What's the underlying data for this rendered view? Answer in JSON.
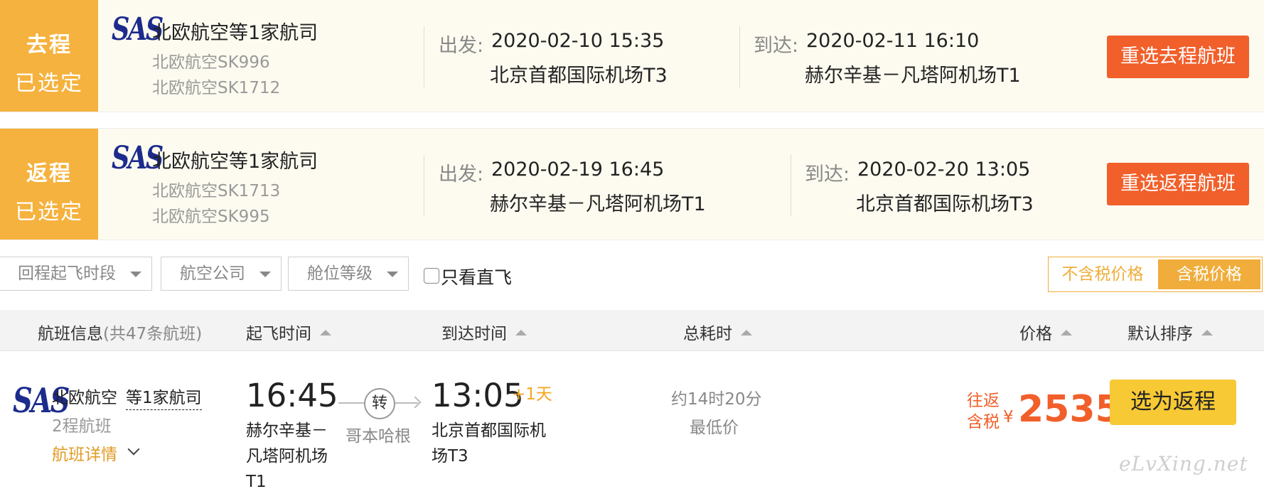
{
  "outbound": {
    "tag_line1": "去程",
    "tag_line2": "已选定",
    "logo": "SAS",
    "airline": "北欧航空等1家航司",
    "flight1": "北欧航空SK996",
    "flight2": "北欧航空SK1712",
    "dep_label": "出发:",
    "dep_datetime": "2020-02-10 15:35",
    "dep_airport": "北京首都国际机场T3",
    "arr_label": "到达:",
    "arr_datetime": "2020-02-11 16:10",
    "arr_airport": "赫尔辛基－凡塔阿机场T1",
    "reselect": "重选去程航班"
  },
  "return": {
    "tag_line1": "返程",
    "tag_line2": "已选定",
    "logo": "SAS",
    "airline": "北欧航空等1家航司",
    "flight1": "北欧航空SK1713",
    "flight2": "北欧航空SK995",
    "dep_label": "出发:",
    "dep_datetime": "2020-02-19 16:45",
    "dep_airport": "赫尔辛基－凡塔阿机场T1",
    "arr_label": "到达:",
    "arr_datetime": "2020-02-20 13:05",
    "arr_airport": "北京首都国际机场T3",
    "reselect": "重选返程航班"
  },
  "filters": {
    "time": "回程起飞时段",
    "airline": "航空公司",
    "cabin": "舱位等级",
    "direct_only": "只看直飞",
    "tax_excluded": "不含税价格",
    "tax_included": "含税价格"
  },
  "table_header": {
    "flight_info": "航班信息",
    "flight_count": "(共47条航班)",
    "dep_time": "起飞时间",
    "arr_time": "到达时间",
    "duration": "总耗时",
    "price": "价格",
    "sort": "默认排序"
  },
  "result": {
    "logo": "SAS",
    "airline": "北欧航空",
    "more_airlines": "等1家航司",
    "segments": "2程航班",
    "details": "航班详情",
    "dep_time": "16:45",
    "dep_airport": "赫尔辛基－凡塔阿机场T1",
    "transfer": "转",
    "via": "哥本哈根",
    "arr_time": "13:05",
    "next_day": "+1天",
    "arr_airport": "北京首都国际机场T3",
    "duration": "约14时20分",
    "lowest": "最低价",
    "price_type1": "往返",
    "price_type2": "含税",
    "currency": "¥",
    "price": "2535",
    "select": "选为返程"
  },
  "watermark": "eLvXing.net",
  "colors": {
    "tag_bg": "#f5b23e",
    "reselect_bg": "#f15f2a",
    "select_bg": "#f7c935",
    "price": "#f15f2a",
    "card_bg": "#fdfbf0"
  }
}
